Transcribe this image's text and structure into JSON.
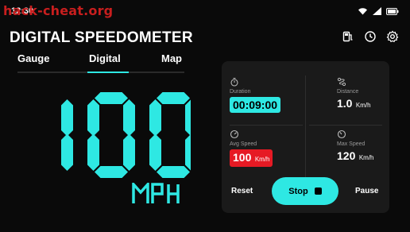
{
  "watermark": "hack-cheat.org",
  "status": {
    "time": "12:30"
  },
  "header": {
    "title": "DIGITAL SPEEDOMETER"
  },
  "tabs": [
    {
      "label": "Gauge",
      "active": false
    },
    {
      "label": "Digital",
      "active": true
    },
    {
      "label": "Map",
      "active": false
    }
  ],
  "speed": {
    "value": "100",
    "unit": "MPH"
  },
  "stats": {
    "duration": {
      "label": "Duration",
      "value": "00:09:00"
    },
    "distance": {
      "label": "Distance",
      "value": "1.0",
      "unit": "Km/h"
    },
    "avg_speed": {
      "label": "Avg Speed",
      "value": "100",
      "unit": "Km/h"
    },
    "max_speed": {
      "label": "Max Speed",
      "value": "120",
      "unit": "Km/h"
    }
  },
  "controls": {
    "reset": "Reset",
    "stop": "Stop",
    "pause": "Pause"
  },
  "colors": {
    "accent": "#2ee8e3",
    "alert": "#e61a24",
    "panel": "#1a1a1a",
    "background": "#0a0a0a"
  },
  "icons": [
    "wifi-icon",
    "signal-icon",
    "battery-icon",
    "fuel-icon",
    "clock-icon",
    "gear-icon",
    "stopwatch-icon",
    "route-icon",
    "speed-icon",
    "gauge-icon",
    "stop-icon"
  ]
}
